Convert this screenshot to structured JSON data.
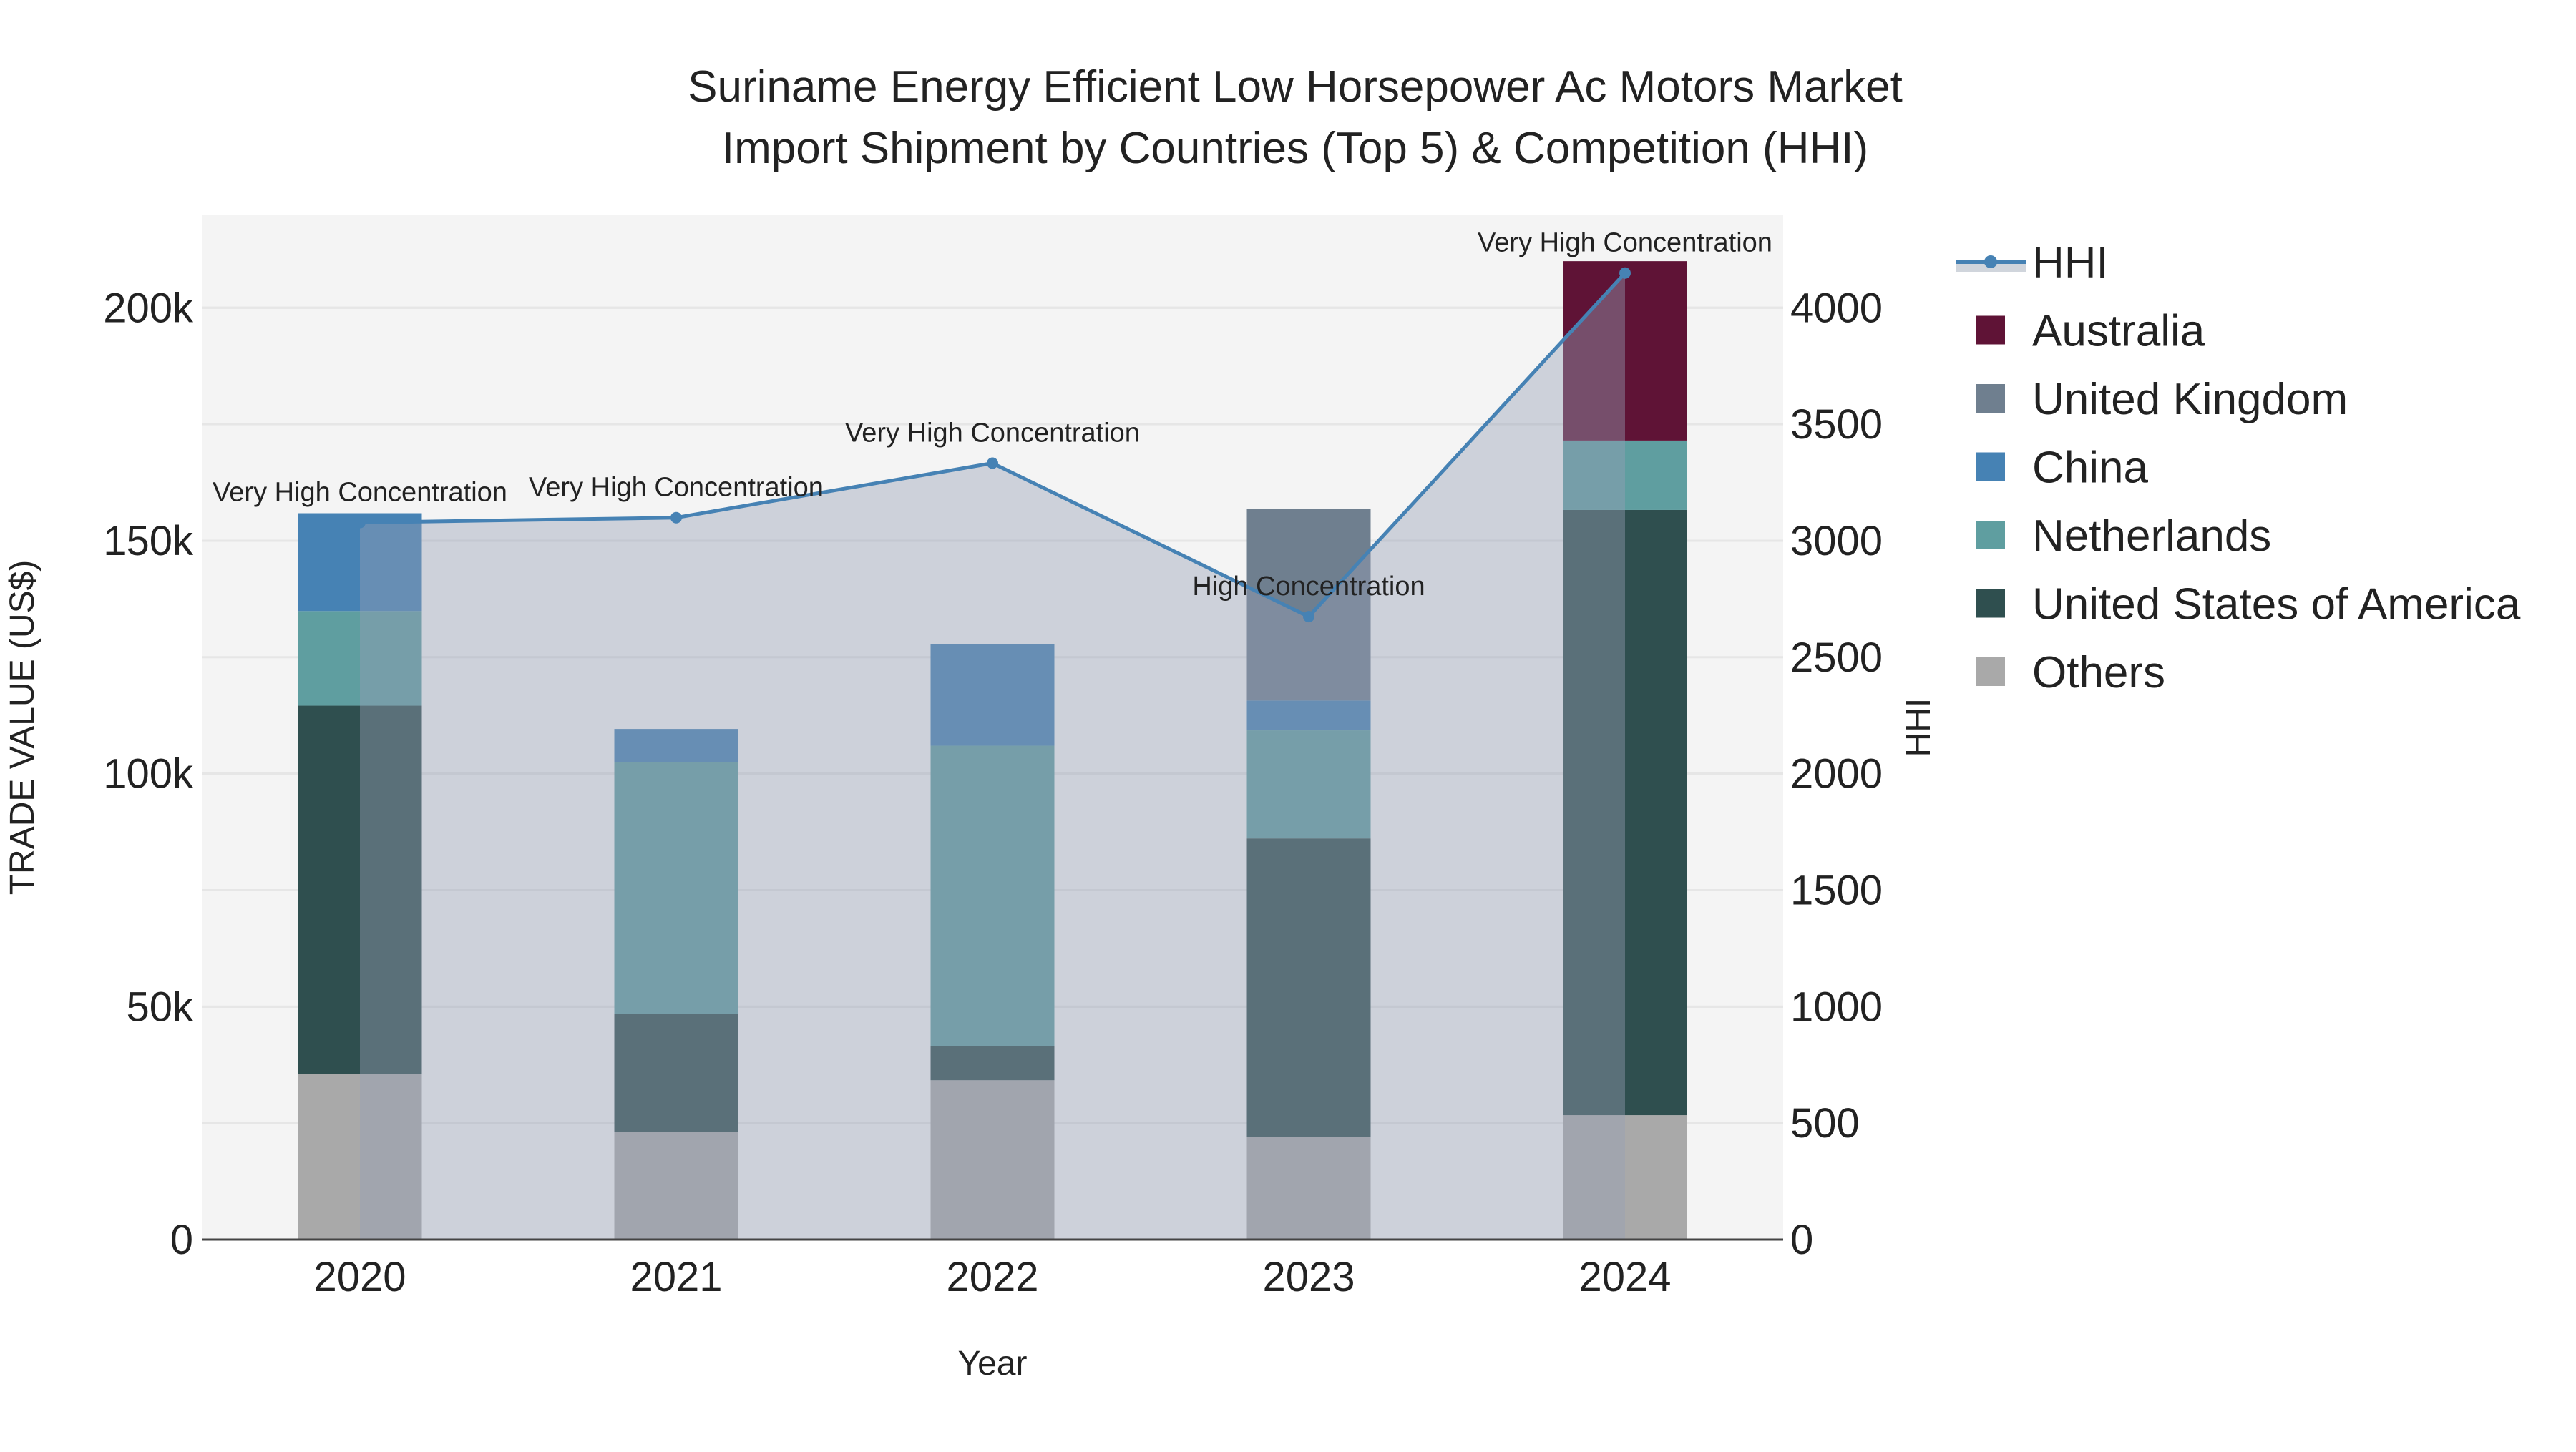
{
  "chart_data": {
    "type": "bar",
    "title_line1": "Suriname Energy Efficient Low Horsepower Ac Motors Market",
    "title_line2": "Import Shipment by Countries (Top 5) & Competition (HHI)",
    "xlabel": "Year",
    "ylabel": "TRADE VALUE (US$)",
    "y2label": "HHI",
    "categories": [
      "2020",
      "2021",
      "2022",
      "2023",
      "2024"
    ],
    "ylim": [
      0,
      220000
    ],
    "y2lim": [
      0,
      4400
    ],
    "yticks": [
      0,
      50000,
      100000,
      150000,
      200000
    ],
    "ytick_labels": [
      "0",
      "50k",
      "100k",
      "150k",
      "200k"
    ],
    "y2ticks": [
      0,
      500,
      1000,
      1500,
      2000,
      2500,
      3000,
      3500,
      4000
    ],
    "y2tick_labels": [
      "0",
      "500",
      "1000",
      "1500",
      "2000",
      "2500",
      "3000",
      "3500",
      "4000"
    ],
    "series": [
      {
        "name": "Others",
        "color": "#a9a9a9",
        "values": [
          35600,
          23100,
          34200,
          22100,
          26700
        ]
      },
      {
        "name": "United States of America",
        "color": "#2f4f4f",
        "values": [
          79000,
          25300,
          7400,
          64000,
          129900
        ]
      },
      {
        "name": "Netherlands",
        "color": "#5f9ea0",
        "values": [
          20300,
          54100,
          64400,
          23200,
          14900
        ]
      },
      {
        "name": "China",
        "color": "#4682b4",
        "values": [
          21000,
          7100,
          21800,
          6400,
          0
        ]
      },
      {
        "name": "United Kingdom",
        "color": "#6f7f8f",
        "values": [
          0,
          0,
          0,
          41200,
          0
        ]
      },
      {
        "name": "Australia",
        "color": "#5f1336",
        "values": [
          0,
          0,
          0,
          0,
          38500
        ]
      }
    ],
    "hhi": {
      "name": "HHI",
      "color": "#4682b4",
      "values": [
        3078,
        3099,
        3333,
        2674,
        4149
      ],
      "annotations": [
        "Very High Concentration",
        "Very High Concentration",
        "Very High Concentration",
        "High Concentration",
        "Very High Concentration"
      ]
    },
    "legend": [
      "HHI",
      "Australia",
      "United Kingdom",
      "China",
      "Netherlands",
      "United States of America",
      "Others"
    ],
    "legend_placement": "right",
    "grid": true
  }
}
